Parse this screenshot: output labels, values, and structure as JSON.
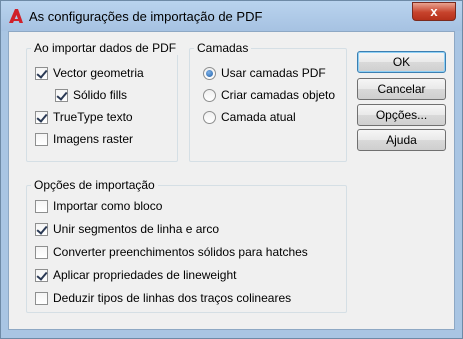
{
  "window": {
    "title": "As configurações de importação de PDF",
    "close_glyph": "x"
  },
  "import_group": {
    "title": "Ao importar dados de PDF",
    "items": [
      {
        "label": "Vector geometria",
        "checked": true
      },
      {
        "label": "Sólido fills",
        "checked": true
      },
      {
        "label": "TrueType texto",
        "checked": true
      },
      {
        "label": "Imagens raster",
        "checked": false
      }
    ]
  },
  "layers_group": {
    "title": "Camadas",
    "options": [
      {
        "label": "Usar camadas PDF",
        "selected": true
      },
      {
        "label": "Criar camadas objeto",
        "selected": false
      },
      {
        "label": "Camada atual",
        "selected": false
      }
    ]
  },
  "options_group": {
    "title": "Opções de importação",
    "items": [
      {
        "label": "Importar como bloco",
        "checked": false
      },
      {
        "label": "Unir segmentos de linha e arco",
        "checked": true
      },
      {
        "label": "Converter preenchimentos sólidos para hatches",
        "checked": false
      },
      {
        "label": "Aplicar propriedades de lineweight",
        "checked": true
      },
      {
        "label": "Deduzir tipos de linhas dos traços colineares",
        "checked": false
      }
    ]
  },
  "buttons": {
    "ok": "OK",
    "cancel": "Cancelar",
    "options": "Opções...",
    "help": "Ajuda"
  },
  "colors": {
    "title_bar": "#a9c5e3",
    "close_button": "#c7432c",
    "dialog_bg": "#f0f0f0",
    "app_icon": "#d0202a"
  }
}
